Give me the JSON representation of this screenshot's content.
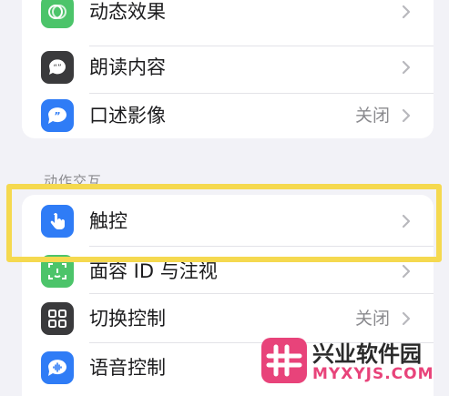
{
  "vision_list": {
    "items": [
      {
        "label": "动态效果",
        "value": "",
        "icon": "motion-icon",
        "icon_color": "#4cc46a"
      },
      {
        "label": "朗读内容",
        "value": "",
        "icon": "speak-icon",
        "icon_color": "#3a3a3c"
      },
      {
        "label": "口述影像",
        "value": "关闭",
        "icon": "audio-description-icon",
        "icon_color": "#2f7cf6"
      }
    ]
  },
  "interaction_section": {
    "header": "动作交互",
    "items": [
      {
        "label": "触控",
        "value": "",
        "icon": "touch-hand-icon",
        "icon_color": "#2f7cf6"
      },
      {
        "label": "面容 ID 与注视",
        "value": "",
        "icon": "face-id-icon",
        "icon_color": "#4cc46a"
      },
      {
        "label": "切换控制",
        "value": "关闭",
        "icon": "switch-control-icon",
        "icon_color": "#3a3a3c"
      },
      {
        "label": "语音控制",
        "value": "",
        "icon": "voice-control-icon",
        "icon_color": "#2f7cf6"
      }
    ]
  },
  "highlight_color": "#f5d94f",
  "watermark": {
    "title": "兴业软件园",
    "url": "MYXYJS.COM",
    "color": "#e8437a"
  }
}
